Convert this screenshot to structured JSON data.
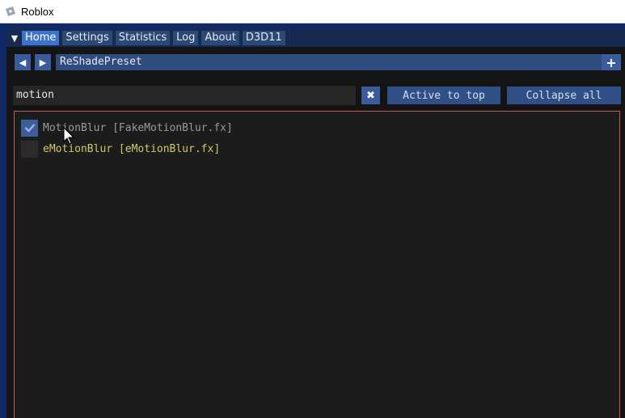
{
  "window": {
    "title": "Roblox"
  },
  "tabs": [
    {
      "label": "Home",
      "active": true
    },
    {
      "label": "Settings",
      "active": false
    },
    {
      "label": "Statistics",
      "active": false
    },
    {
      "label": "Log",
      "active": false
    },
    {
      "label": "About",
      "active": false
    },
    {
      "label": "D3D11",
      "active": false
    }
  ],
  "preset": {
    "name": "ReShadePreset",
    "prev_icon": "triangle-left-icon",
    "next_icon": "triangle-right-icon",
    "add_icon": "plus-icon"
  },
  "search": {
    "value": "motion",
    "clear_icon": "x-icon",
    "active_to_top_label": "Active to top",
    "collapse_all_label": "Collapse all"
  },
  "effects": [
    {
      "label": "MotionBlur [FakeMotionBlur.fx]",
      "checked": true
    },
    {
      "label": "eMotionBlur [eMotionBlur.fx]",
      "checked": false
    }
  ],
  "colors": {
    "accent": "#3f72c9",
    "active_effect_text": "#cfc86a",
    "inactive_effect_text": "#9a9a9a",
    "list_border": "#c45a5a"
  }
}
